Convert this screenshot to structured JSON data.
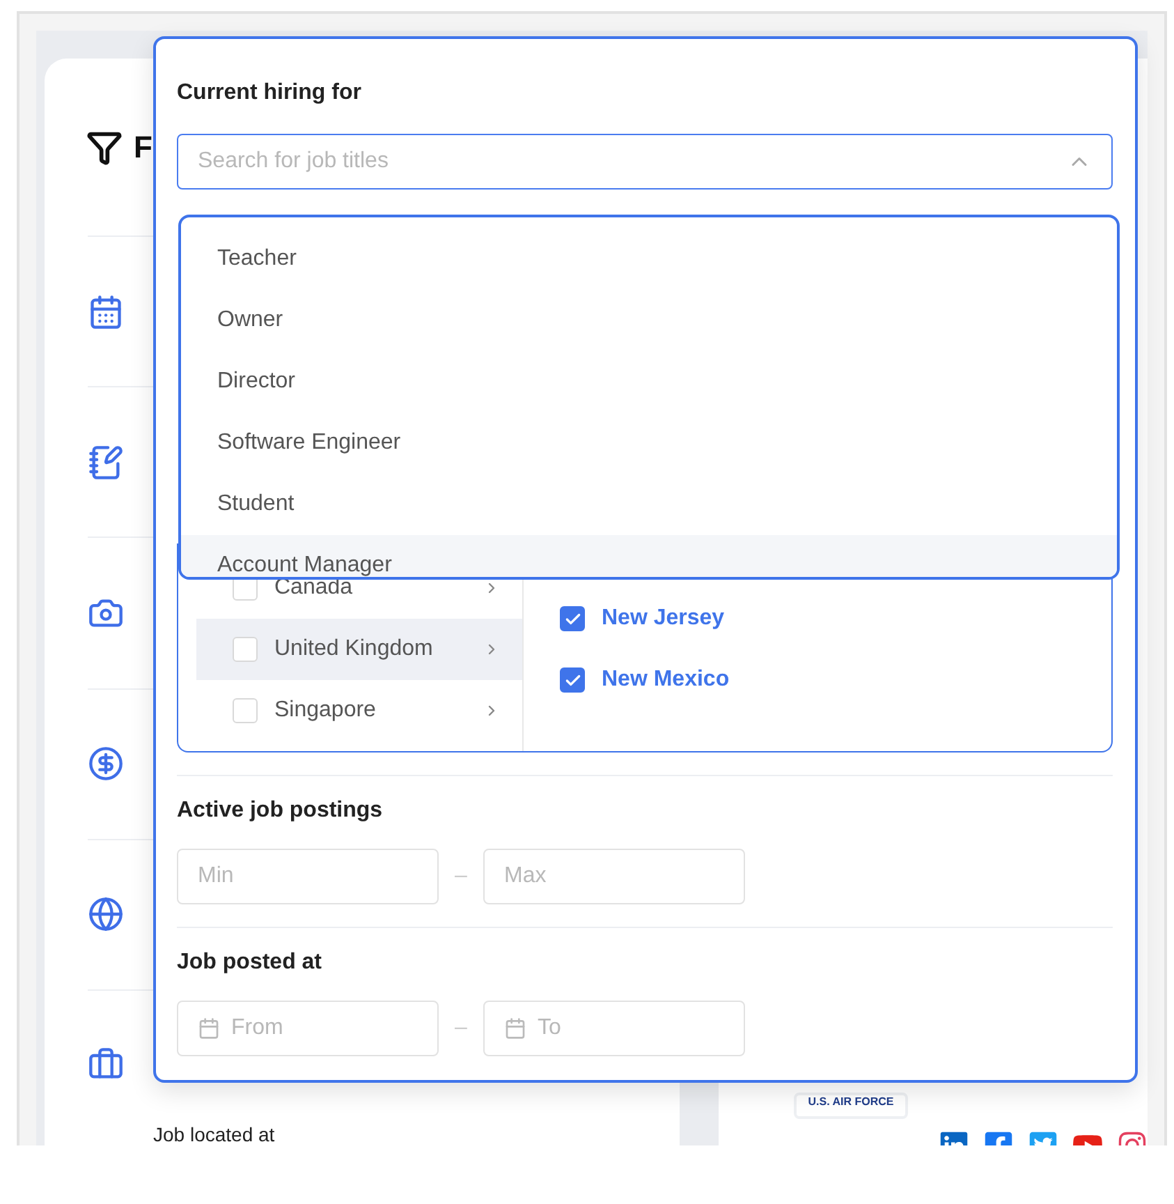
{
  "sidebar": {
    "title": "F",
    "footer_label": "Job located at",
    "items": [
      {
        "kind": "calendar"
      },
      {
        "kind": "edit"
      },
      {
        "kind": "upload"
      },
      {
        "kind": "dollar"
      },
      {
        "kind": "globe"
      },
      {
        "kind": "briefcase"
      }
    ]
  },
  "company": {
    "logo_text": "U.S. AIR FORCE",
    "socials": [
      {
        "kind": "linkedin"
      },
      {
        "kind": "facebook"
      },
      {
        "kind": "twitter"
      },
      {
        "kind": "youtube"
      },
      {
        "kind": "instagram"
      }
    ]
  },
  "popup": {
    "hiring": {
      "label": "Current hiring for",
      "placeholder": "Search for job titles",
      "expanded": true,
      "options": [
        {
          "label": "Teacher",
          "highlighted": false
        },
        {
          "label": "Owner",
          "highlighted": false
        },
        {
          "label": "Director",
          "highlighted": false
        },
        {
          "label": "Software Engineer",
          "highlighted": false
        },
        {
          "label": "Student",
          "highlighted": false
        },
        {
          "label": "Account Manager",
          "highlighted": true
        }
      ]
    },
    "location": {
      "countries": [
        {
          "label": "Canada",
          "checked": false,
          "selected": false
        },
        {
          "label": "United Kingdom",
          "checked": false,
          "selected": true
        },
        {
          "label": "Singapore",
          "checked": false,
          "selected": false
        }
      ],
      "regions": [
        {
          "label": "New Jersey",
          "checked": true
        },
        {
          "label": "New Mexico",
          "checked": true
        }
      ]
    },
    "postings": {
      "label": "Active job postings",
      "min_placeholder": "Min",
      "separator": "–",
      "max_placeholder": "Max"
    },
    "posted": {
      "label": "Job posted at",
      "from_placeholder": "From",
      "separator": "–",
      "to_placeholder": "To"
    }
  }
}
